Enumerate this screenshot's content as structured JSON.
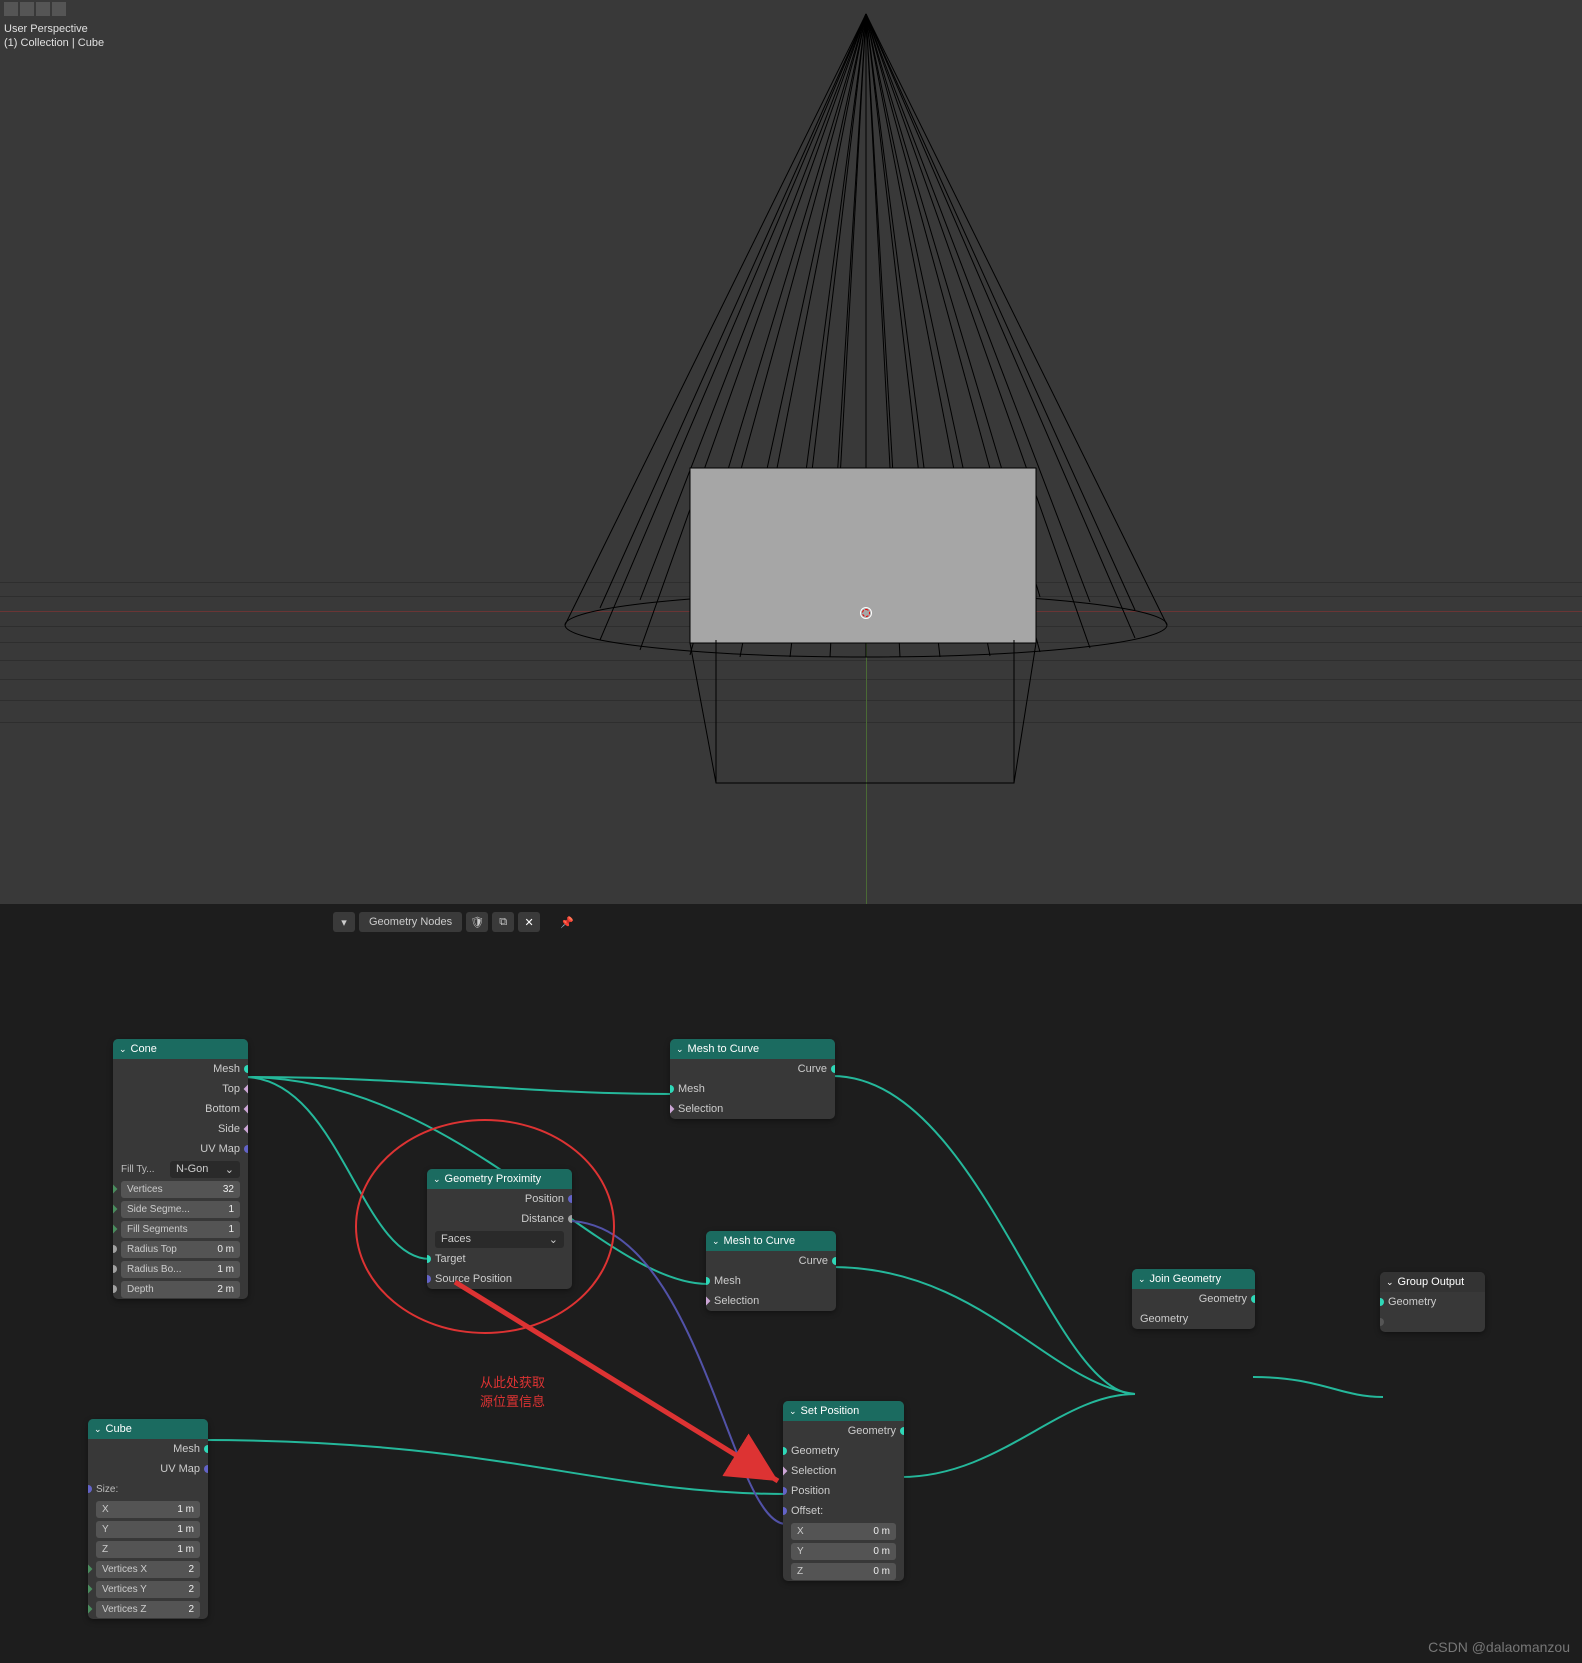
{
  "viewport": {
    "perspective": "User Perspective",
    "breadcrumb": "(1) Collection | Cube"
  },
  "nodeEditor": {
    "title": "Geometry Nodes",
    "shieldIcon": "🛡",
    "copyIcon": "⧉",
    "closeIcon": "✕",
    "pinIcon": "📌"
  },
  "nodes": {
    "cone": {
      "title": "Cone",
      "out": {
        "mesh": "Mesh",
        "top": "Top",
        "bottom": "Bottom",
        "side": "Side",
        "uv": "UV Map"
      },
      "fillLabel": "Fill Ty...",
      "fillValue": "N-Gon",
      "props": [
        {
          "k": "Vertices",
          "v": "32"
        },
        {
          "k": "Side Segme...",
          "v": "1"
        },
        {
          "k": "Fill Segments",
          "v": "1"
        },
        {
          "k": "Radius Top",
          "v": "0 m"
        },
        {
          "k": "Radius Bo...",
          "v": "1 m"
        },
        {
          "k": "Depth",
          "v": "2 m"
        }
      ]
    },
    "cube": {
      "title": "Cube",
      "out": {
        "mesh": "Mesh",
        "uv": "UV Map"
      },
      "sizeLabel": "Size:",
      "size": [
        {
          "k": "X",
          "v": "1 m"
        },
        {
          "k": "Y",
          "v": "1 m"
        },
        {
          "k": "Z",
          "v": "1 m"
        }
      ],
      "verts": [
        {
          "k": "Vertices X",
          "v": "2"
        },
        {
          "k": "Vertices Y",
          "v": "2"
        },
        {
          "k": "Vertices Z",
          "v": "2"
        }
      ]
    },
    "prox": {
      "title": "Geometry Proximity",
      "out": {
        "position": "Position",
        "distance": "Distance"
      },
      "modeValue": "Faces",
      "in": {
        "target": "Target",
        "source": "Source Position"
      }
    },
    "m2c": {
      "title": "Mesh to Curve",
      "out": {
        "curve": "Curve"
      },
      "in": {
        "mesh": "Mesh",
        "sel": "Selection"
      }
    },
    "setpos": {
      "title": "Set Position",
      "out": {
        "geo": "Geometry"
      },
      "in": {
        "geo": "Geometry",
        "sel": "Selection",
        "pos": "Position",
        "off": "Offset:"
      },
      "offset": [
        {
          "k": "X",
          "v": "0 m"
        },
        {
          "k": "Y",
          "v": "0 m"
        },
        {
          "k": "Z",
          "v": "0 m"
        }
      ]
    },
    "join": {
      "title": "Join Geometry",
      "out": {
        "geo": "Geometry"
      },
      "in": {
        "geo": "Geometry"
      }
    },
    "groupout": {
      "title": "Group Output",
      "in": {
        "geo": "Geometry"
      }
    }
  },
  "annotation": {
    "line1": "从此处获取",
    "line2": "源位置信息"
  },
  "watermark": "CSDN @dalaomanzou"
}
